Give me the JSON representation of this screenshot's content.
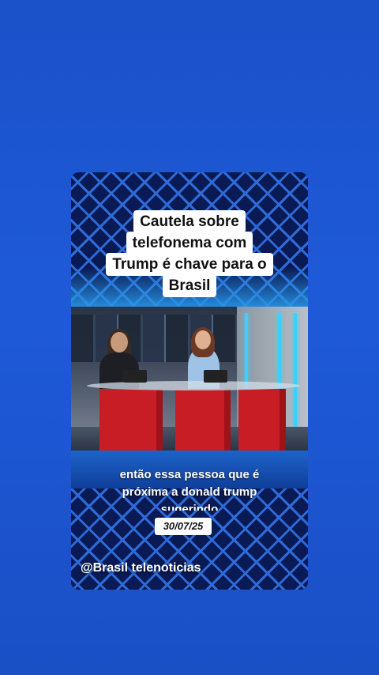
{
  "headline": {
    "lines": [
      "Cautela sobre",
      "telefonema com",
      "Trump é chave para o",
      "Brasil"
    ]
  },
  "caption": {
    "line1": "então essa pessoa que é",
    "line2": "próxima a donald trump",
    "line3": "sugerindo"
  },
  "date": "30/07/25",
  "watermark": "@Brasil telenoticias",
  "colors": {
    "background": "#1e5ad8",
    "accent_red": "#c81d25",
    "neon": "#3cd0ff"
  }
}
